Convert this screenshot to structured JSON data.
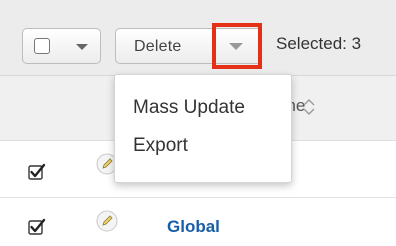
{
  "toolbar": {
    "delete_label": "Delete",
    "selected_text": "Selected: 3"
  },
  "table": {
    "column_label": "Name",
    "rows": [
      {
        "checked": true,
        "name": ""
      },
      {
        "checked": true,
        "name": "Global"
      }
    ]
  },
  "actions_menu": {
    "items": [
      "Mass Update",
      "Export"
    ]
  },
  "colors": {
    "highlight": "#e53018",
    "link": "#1a5ea8",
    "toolbar_bg": "#ececec"
  },
  "icons": {
    "mass_select": "checkbox-icon",
    "dropdown": "chevron-down-icon",
    "sort": "sort-icon",
    "edit": "pencil-icon"
  }
}
